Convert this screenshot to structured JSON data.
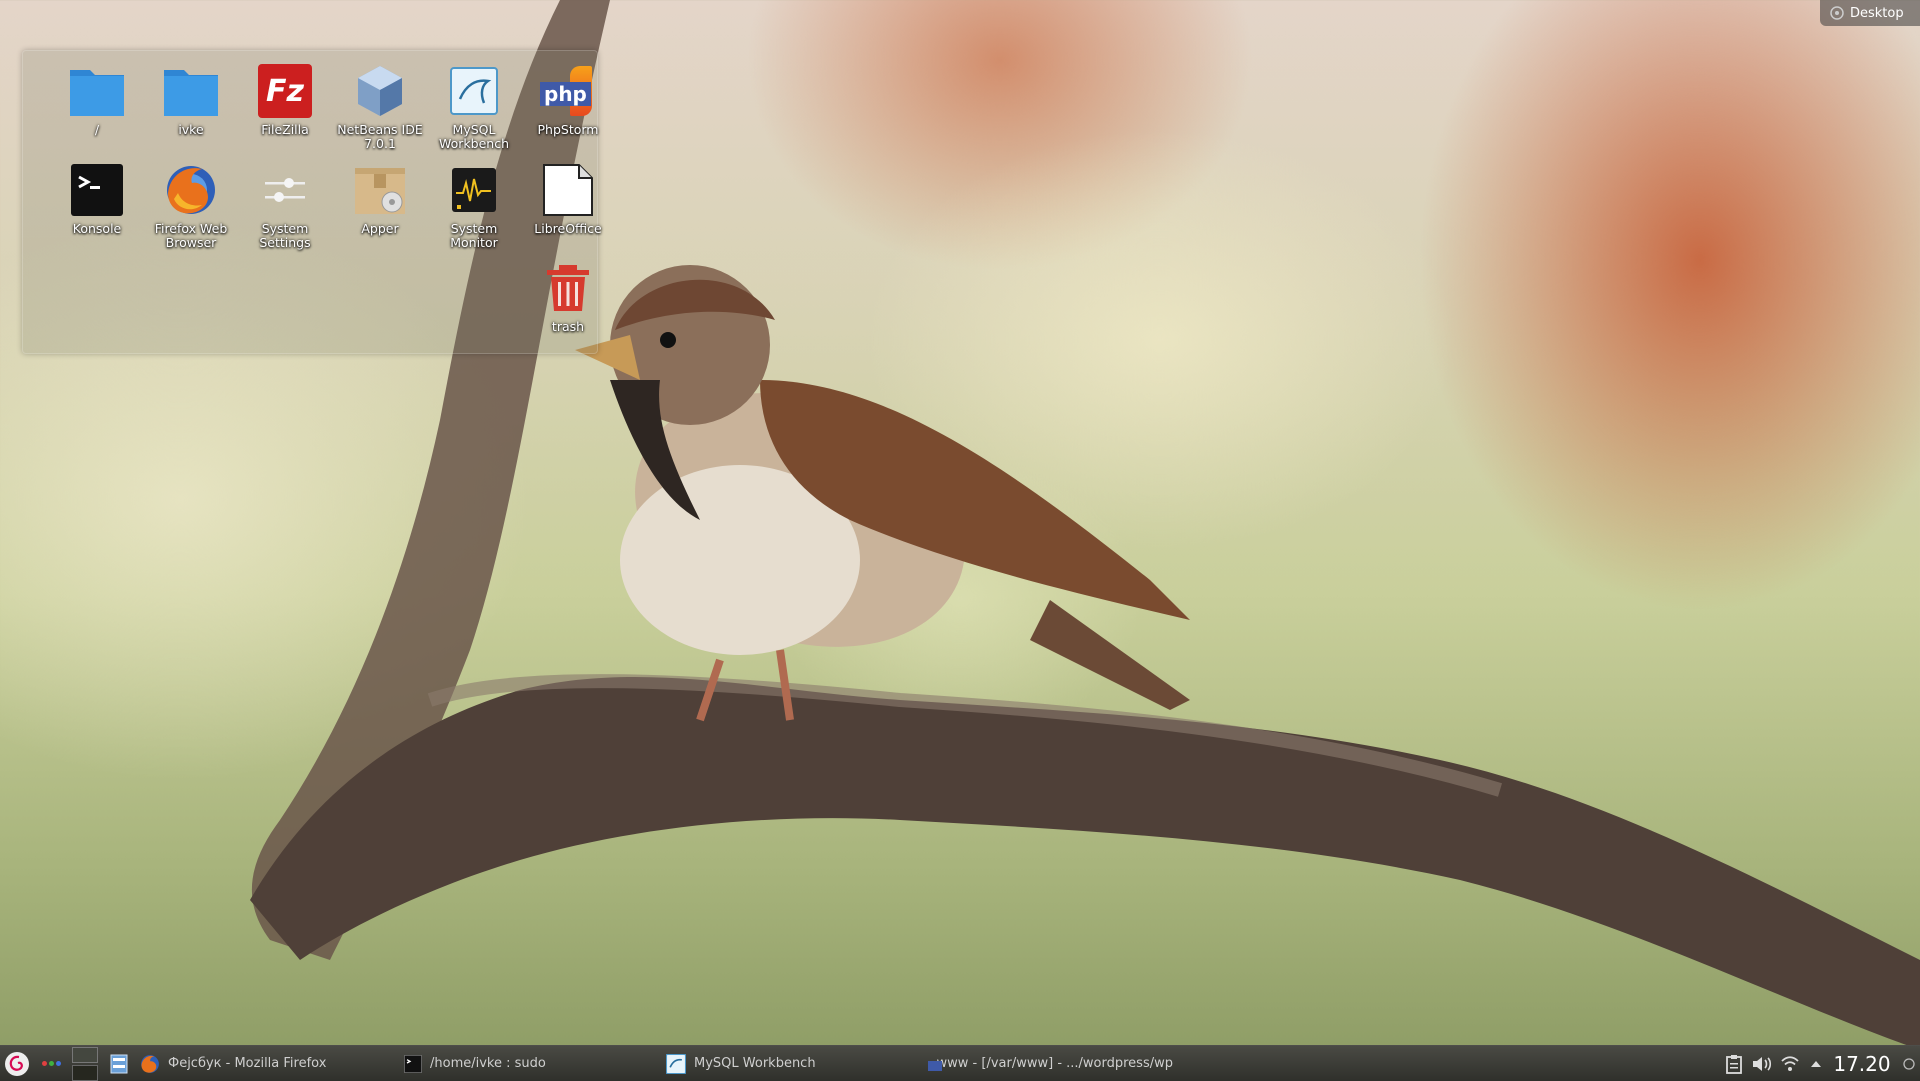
{
  "desktop": {
    "toolbox_label": "Desktop"
  },
  "folder_view": {
    "icons": [
      {
        "label": "/",
        "icon": "folder-icon"
      },
      {
        "label": "ivke",
        "icon": "folder-icon"
      },
      {
        "label": "FileZilla",
        "icon": "filezilla-icon"
      },
      {
        "label": "NetBeans IDE 7.0.1",
        "icon": "netbeans-icon"
      },
      {
        "label": "MySQL Workbench",
        "icon": "mysql-workbench-icon"
      },
      {
        "label": "PhpStorm",
        "icon": "phpstorm-icon"
      },
      {
        "label": "Konsole",
        "icon": "terminal-icon"
      },
      {
        "label": "Firefox Web Browser",
        "icon": "firefox-icon"
      },
      {
        "label": "System Settings",
        "icon": "settings-sliders-icon"
      },
      {
        "label": "Apper",
        "icon": "package-box-icon"
      },
      {
        "label": "System Monitor",
        "icon": "system-monitor-icon"
      },
      {
        "label": "LibreOffice",
        "icon": "document-icon"
      },
      {
        "label": "trash",
        "icon": "trash-icon"
      }
    ],
    "filezilla_glyph": "Fz",
    "phpstorm_glyph": "php"
  },
  "taskbar": {
    "tasks": [
      {
        "label": "Фејсбук - Mozilla Firefox",
        "icon": "firefox-icon"
      },
      {
        "label": "/home/ivke : sudo",
        "icon": "terminal-icon"
      },
      {
        "label": "MySQL Workbench",
        "icon": "mysql-workbench-icon"
      },
      {
        "label": "www - [/var/www] - .../wordpress/wp",
        "icon": "phpstorm-icon"
      }
    ],
    "clock": "17.20"
  },
  "colors": {
    "folder_blue": "#3d9be6",
    "filezilla_red": "#cc1f1f",
    "trash_red": "#d63a2e",
    "panel_dark": "#2f302b"
  }
}
